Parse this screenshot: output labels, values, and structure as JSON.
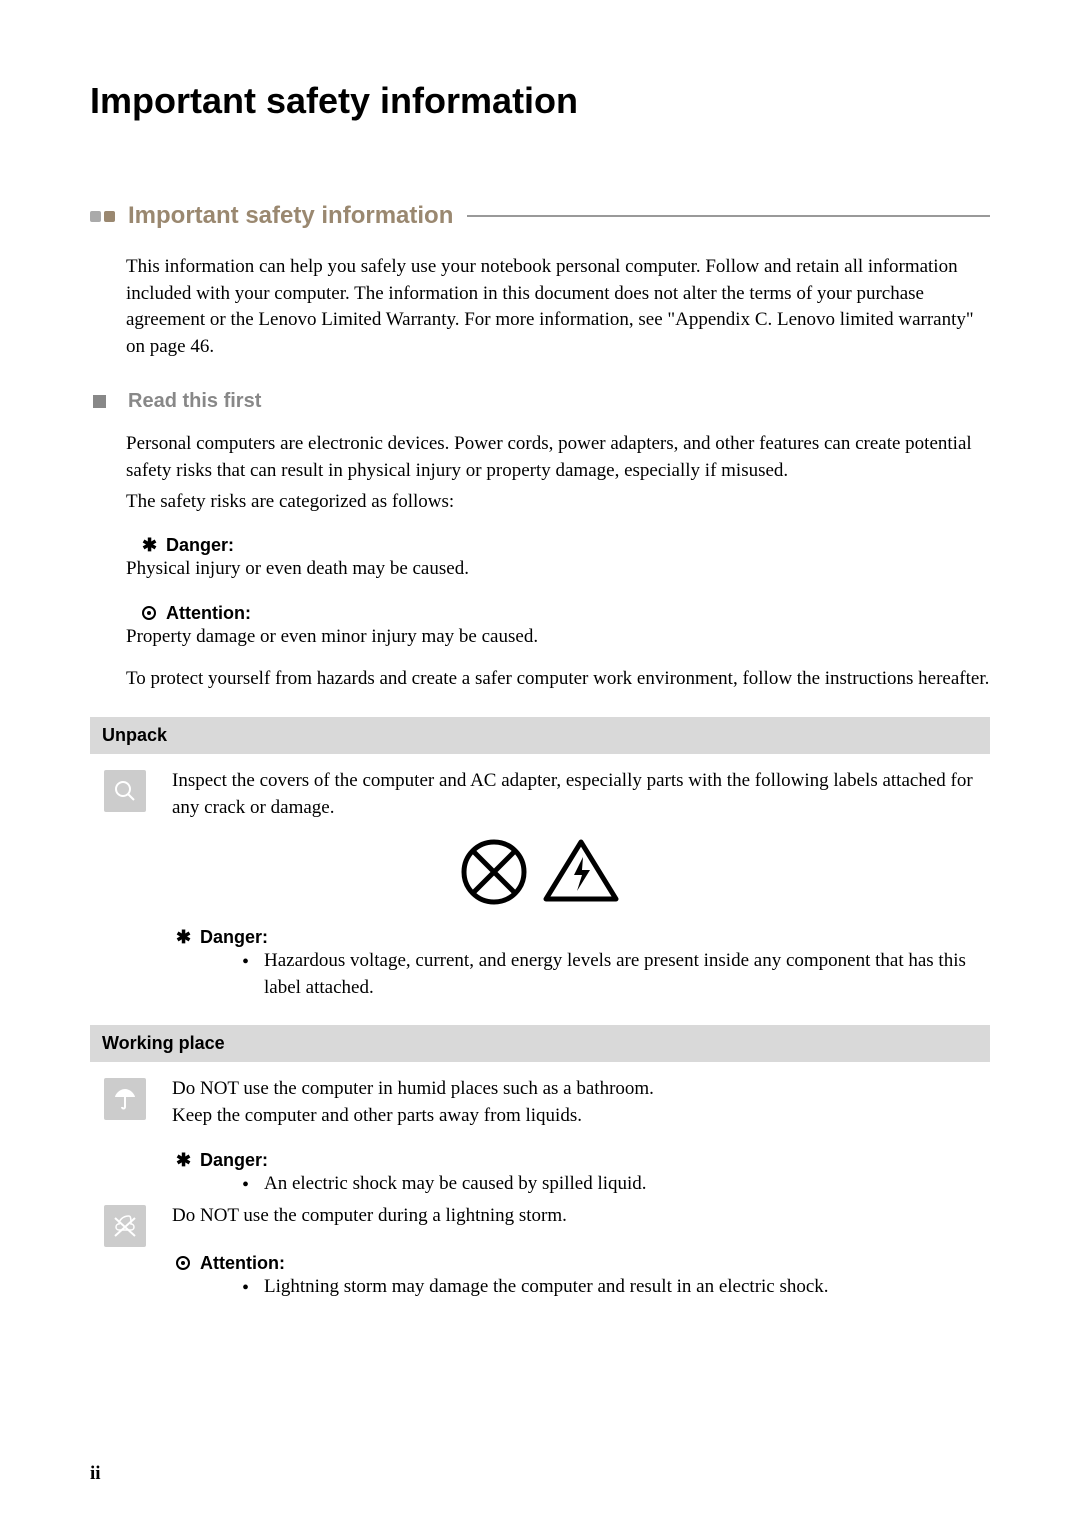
{
  "page_title": "Important safety information",
  "section": {
    "title": "Important safety information",
    "intro": "This information can help you safely use your notebook personal computer. Follow and retain all information included with your computer. The information in this document does not alter the terms of your purchase agreement or the Lenovo Limited Warranty. For more information, see \"Appendix C. Lenovo limited warranty\" on page 46."
  },
  "read_first": {
    "title": "Read this first",
    "para1": "Personal computers are electronic devices. Power cords, power adapters, and other features can create potential safety risks that can result in physical injury or property damage, especially if misused.",
    "para2": "The safety risks are categorized as follows:",
    "danger_label": "Danger:",
    "danger_text": "Physical injury or even death may be caused.",
    "attention_label": "Attention:",
    "attention_text": "Property damage or even minor injury may be caused.",
    "closing": "To protect yourself from hazards and create a safer computer work environment, follow the instructions hereafter."
  },
  "unpack": {
    "heading": "Unpack",
    "text": "Inspect the covers of the computer and AC adapter, especially parts with the following labels attached for any crack or damage.",
    "danger_label": "Danger:",
    "danger_bullet": "Hazardous voltage, current, and energy levels are present inside any component that has this label attached."
  },
  "working_place": {
    "heading": "Working place",
    "line1": "Do NOT use the computer in humid places such as a bathroom.",
    "line2": "Keep the computer and other parts away from liquids.",
    "danger_label": "Danger:",
    "danger_bullet": "An electric shock may be caused by spilled liquid.",
    "line3": "Do NOT use the computer during a lightning storm.",
    "attention_label": "Attention:",
    "attention_bullet": "Lightning storm may damage the computer and result in an electric shock."
  },
  "page_number": "ii"
}
